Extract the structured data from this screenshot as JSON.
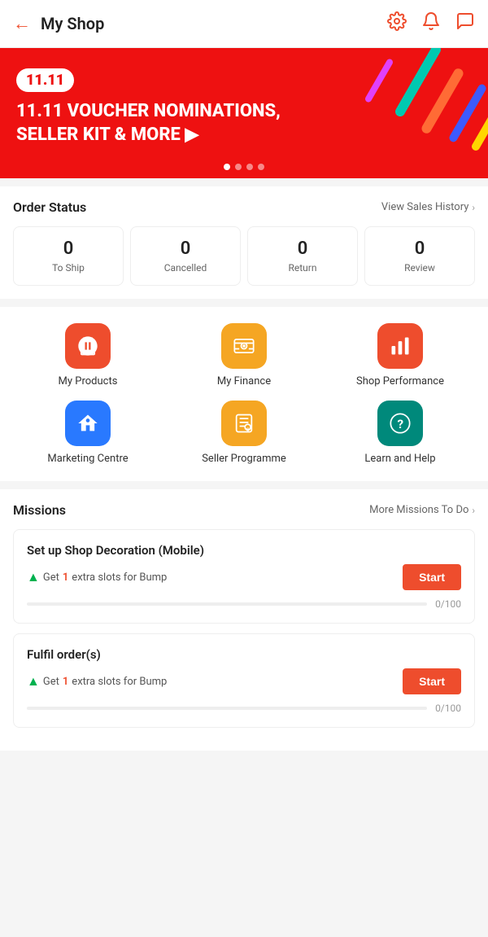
{
  "header": {
    "back_icon": "←",
    "title": "My Shop",
    "settings_icon": "⚙",
    "notifications_icon": "🔔",
    "chat_icon": "💬"
  },
  "banner": {
    "badge": "11.11",
    "text": "11.11 VOUCHER NOMINATIONS,\nSELLER KIT & MORE",
    "arrow": "▶",
    "dots": [
      true,
      false,
      false,
      false
    ]
  },
  "order_status": {
    "title": "Order Status",
    "view_link": "View Sales History",
    "items": [
      {
        "count": "0",
        "label": "To Ship"
      },
      {
        "count": "0",
        "label": "Cancelled"
      },
      {
        "count": "0",
        "label": "Return"
      },
      {
        "count": "0",
        "label": "Review"
      }
    ]
  },
  "features": {
    "items": [
      {
        "id": "my-products",
        "label": "My Products",
        "icon_color": "icon-orange",
        "icon": "box"
      },
      {
        "id": "my-finance",
        "label": "My Finance",
        "icon_color": "icon-yellow",
        "icon": "finance"
      },
      {
        "id": "shop-performance",
        "label": "Shop Performance",
        "icon_color": "icon-red",
        "icon": "chart"
      },
      {
        "id": "marketing-centre",
        "label": "Marketing Centre",
        "icon_color": "icon-blue",
        "icon": "marketing"
      },
      {
        "id": "seller-programme",
        "label": "Seller Programme",
        "icon_color": "icon-gold",
        "icon": "seller"
      },
      {
        "id": "learn-and-help",
        "label": "Learn and Help",
        "icon_color": "icon-teal",
        "icon": "help"
      }
    ]
  },
  "missions": {
    "title": "Missions",
    "more_link": "More Missions To Do",
    "items": [
      {
        "title": "Set up Shop Decoration (Mobile)",
        "reward_prefix": "Get ",
        "reward_highlight": "1",
        "reward_suffix": " extra slots for Bump",
        "progress_current": 0,
        "progress_total": 100,
        "progress_label": "0/100",
        "button_label": "Start"
      },
      {
        "title": "Fulfil order(s)",
        "reward_prefix": "Get ",
        "reward_highlight": "1",
        "reward_suffix": " extra slots for Bump",
        "progress_current": 0,
        "progress_total": 100,
        "progress_label": "0/100",
        "button_label": "Start"
      }
    ]
  }
}
